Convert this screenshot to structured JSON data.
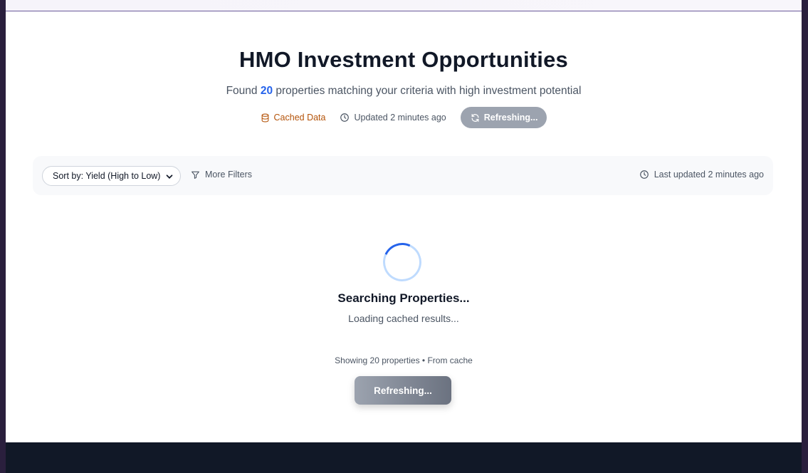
{
  "header": {
    "title": "HMO Investment Opportunities",
    "subtitle_prefix": "Found",
    "result_count": "20",
    "subtitle_suffix": "properties matching your criteria with high investment potential"
  },
  "status": {
    "cached_label": "Cached Data",
    "updated_label": "Updated 2 minutes ago",
    "refresh_label": "Refreshing..."
  },
  "filters": {
    "sort_value": "Sort by: Yield (High to Low)",
    "more_filters_label": "More Filters",
    "last_updated_label": "Last updated 2 minutes ago"
  },
  "loading": {
    "heading": "Searching Properties...",
    "subtext": "Loading cached results..."
  },
  "results": {
    "showing_text": "Showing 20 properties • From cache",
    "refresh_button_label": "Refreshing..."
  },
  "colors": {
    "accent": "#2563eb",
    "cached": "#b45309",
    "refresh_disabled": "#9ca3af",
    "footer": "#111827"
  },
  "icons": {
    "cached": "database-icon",
    "updated": "clock-icon",
    "refresh": "refresh-icon",
    "filter": "filter-icon",
    "sort": "chevron-down-icon"
  }
}
